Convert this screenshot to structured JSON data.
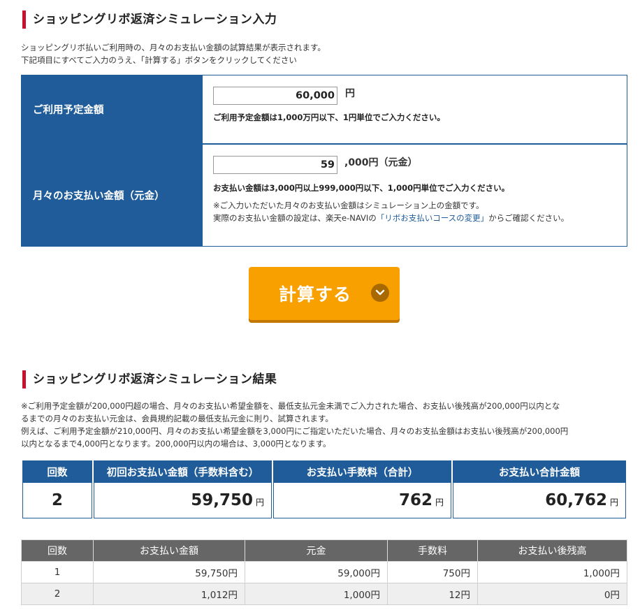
{
  "input_section": {
    "title": "ショッピングリボ返済シミュレーション入力",
    "desc_line1": "ショッピングリボ払いご利用時の、月々のお支払い金額の試算結果が表示されます。",
    "desc_line2": "下記項目にすべてご入力のうえ、「計算する」ボタンをクリックしてください",
    "usage": {
      "label": "ご利用予定金額",
      "value": "60,000",
      "unit": "円",
      "note": "ご利用予定金額は1,000万円以下、1円単位でご入力ください。"
    },
    "monthly": {
      "label": "月々のお支払い金額（元金）",
      "value": "59",
      "unit": ",000円（元金）",
      "note_bold": "お支払い金額は3,000円以上999,000円以下、1,000円単位でご入力ください。",
      "note1": "※ご入力いただいた月々のお支払い金額はシミュレーション上の金額です。",
      "note2_pre": "実際のお支払い金額の設定は、楽天e-NAVIの",
      "note2_link": "「リボお支払いコースの変更」",
      "note2_post": "からご確認ください。"
    },
    "calc_button": "計算する"
  },
  "result_section": {
    "title": "ショッピングリボ返済シミュレーション結果",
    "desc_line1": "※ご利用予定金額が200,000円超の場合、月々のお支払い希望金額を、最低支払元金未満でご入力された場合、お支払い後残高が200,000円以内とな",
    "desc_line2": "るまでの月々のお支払い元金は、会員規約記載の最低支払元金に則り、試算されます。",
    "desc_line3": "例えば、ご利用予定金額が210,000円、月々のお支払い希望金額を3,000円にご指定いただいた場合、月々のお支払金額はお支払い後残高が200,000円",
    "desc_line4": "以内となるまで4,000円となります。200,000円以内の場合は、3,000円となります。",
    "summary": {
      "headers": [
        "回数",
        "初回お支払い金額（手数料含む）",
        "お支払い手数料（合計）",
        "お支払い合計金額"
      ],
      "count": "2",
      "first_payment": "59,750",
      "fee_total": "762",
      "total": "60,762",
      "yen": "円"
    },
    "detail": {
      "headers": [
        "回数",
        "お支払い金額",
        "元金",
        "手数料",
        "お支払い後残高"
      ],
      "rows": [
        [
          "1",
          "59,750円",
          "59,000円",
          "750円",
          "1,000円"
        ],
        [
          "2",
          "1,012円",
          "1,000円",
          "12円",
          "0円"
        ]
      ]
    }
  }
}
